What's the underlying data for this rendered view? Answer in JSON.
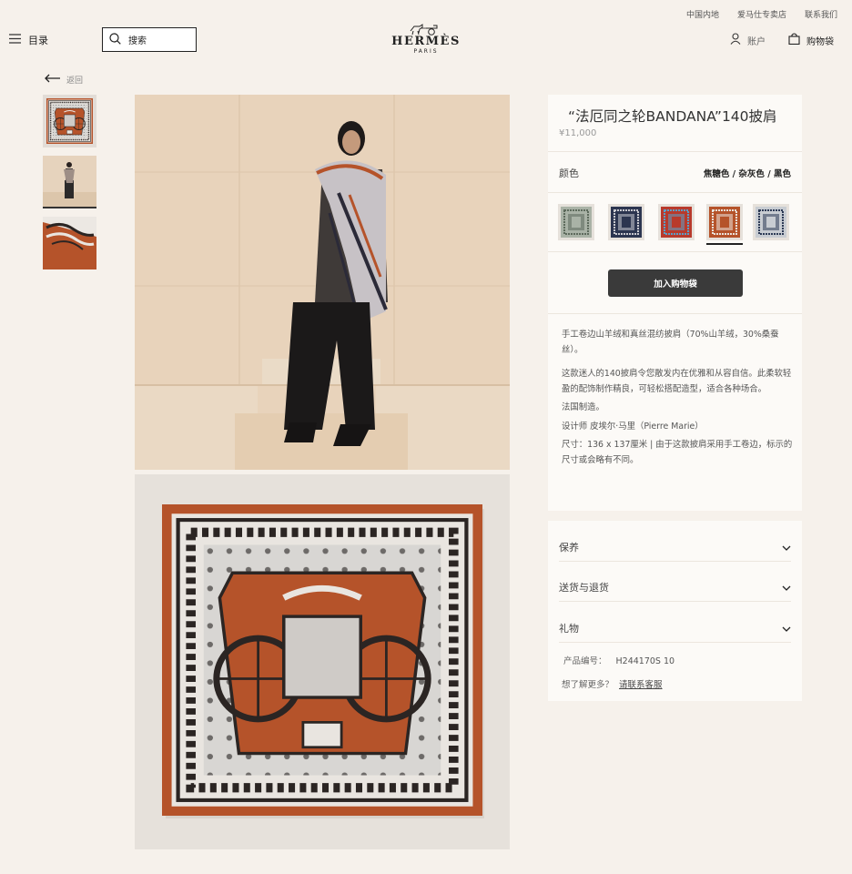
{
  "topbar": {
    "links": [
      "中国内地",
      "爱马仕专卖店",
      "联系我们"
    ]
  },
  "header": {
    "menu_label": "目录",
    "search_placeholder": "搜索",
    "logo_word": "HERMÈS",
    "logo_sub": "PARIS",
    "account_label": "账户",
    "bag_label": "购物袋"
  },
  "nav": {
    "back_label": "返回"
  },
  "product": {
    "title": "“法厄同之轮BANDANA”140披肩",
    "price": "¥11,000",
    "color_label": "颜色",
    "color_value": "焦糖色 / 杂灰色 / 黑色",
    "swatches": [
      {
        "name": "sage",
        "color": "#a9b2a6",
        "accent": "#5d6a5c"
      },
      {
        "name": "navy",
        "color": "#2c3550",
        "accent": "#c9c9cf"
      },
      {
        "name": "red-blue",
        "color": "#b83a2c",
        "accent": "#5aa0c8"
      },
      {
        "name": "caramel",
        "color": "#b5532a",
        "accent": "#e9e3dc"
      },
      {
        "name": "grey",
        "color": "#c8ccd2",
        "accent": "#2d3a55"
      }
    ],
    "selected_swatch": 3,
    "add_to_bag_label": "加入购物袋",
    "description": [
      "手工卷边山羊绒和真丝混纺披肩（70%山羊绒，30%桑蚕丝）。",
      "这款迷人的140披肩令您散发内在优雅和从容自信。此柔软轻盈的配饰制作精良，可轻松搭配造型，适合各种场合。",
      "法国制造。",
      "设计师 皮埃尔·马里（Pierre Marie）",
      "尺寸：136 x 137厘米 | 由于这款披肩采用手工卷边，标示的尺寸或会略有不同。"
    ]
  },
  "details": {
    "accordions": [
      "保养",
      "送货与退货",
      "礼物"
    ],
    "ref_label": "产品编号：",
    "ref_value": "H244170S 10",
    "help_text": "想了解更多？",
    "contact_link": "请联系客服"
  },
  "colors": {
    "background": "#f6f1eb",
    "panel": "#fcfaf7",
    "button": "#3a3a3a",
    "scarf_caramel": "#b5532a"
  }
}
